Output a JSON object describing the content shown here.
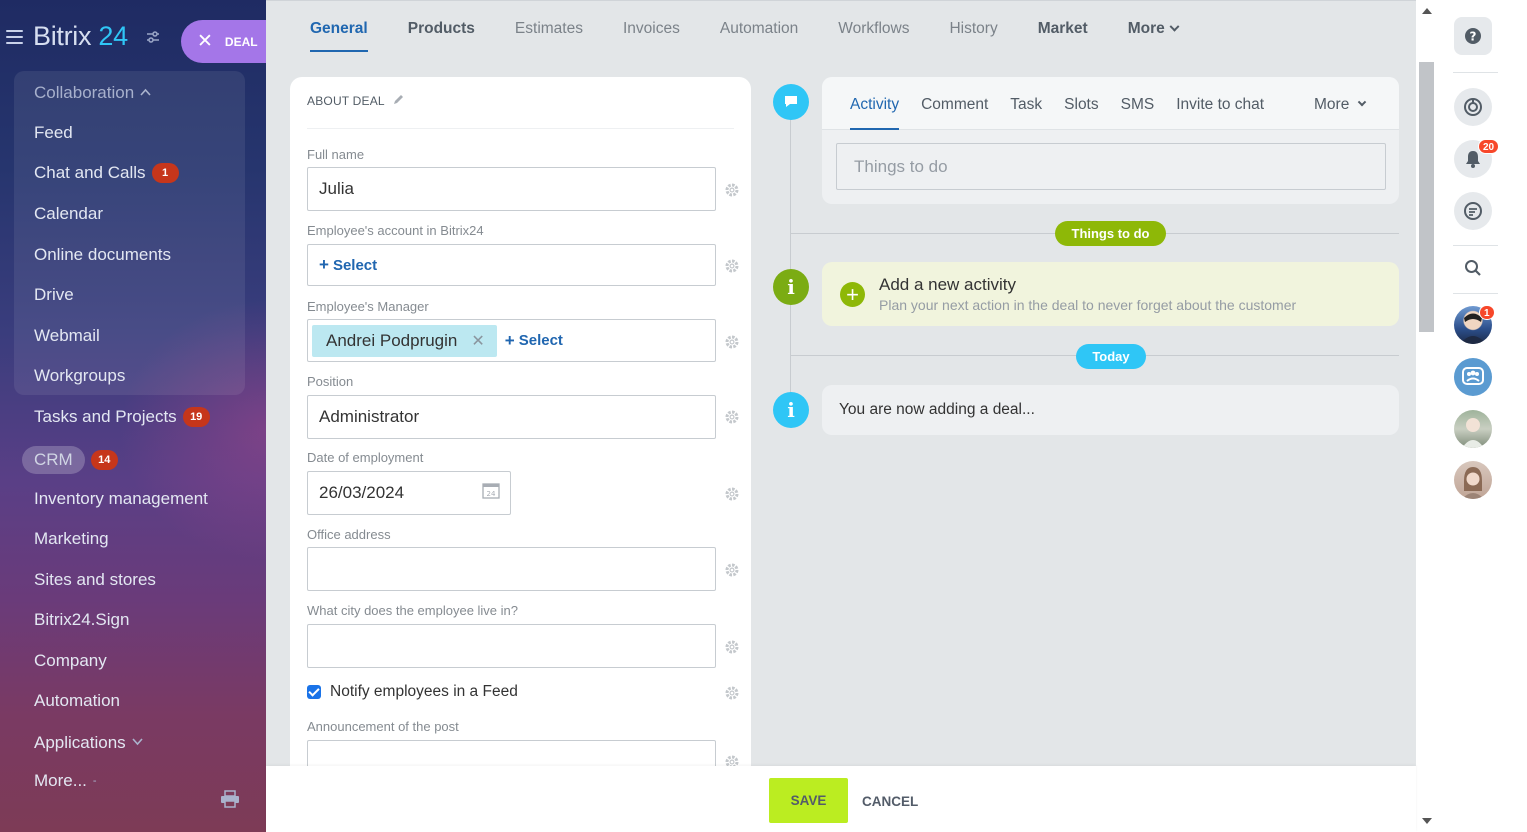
{
  "sidebar": {
    "logo": {
      "text": "Bitrix",
      "num": "24"
    },
    "deal_button": "DEAL",
    "items": [
      {
        "label": "Collaboration",
        "chevron": "^"
      },
      {
        "label": "Feed"
      },
      {
        "label": "Chat and Calls",
        "badge": "1"
      },
      {
        "label": "Calendar"
      },
      {
        "label": "Online documents"
      },
      {
        "label": "Drive"
      },
      {
        "label": "Webmail"
      },
      {
        "label": "Workgroups"
      },
      {
        "label": "Tasks and Projects",
        "badge": "19"
      },
      {
        "label": "CRM",
        "badge": "14"
      },
      {
        "label": "Inventory management"
      },
      {
        "label": "Marketing"
      },
      {
        "label": "Sites and stores"
      },
      {
        "label": "Bitrix24.Sign"
      },
      {
        "label": "Company"
      },
      {
        "label": "Automation"
      },
      {
        "label": "Applications"
      },
      {
        "label": "More..."
      }
    ]
  },
  "tabs": [
    "General",
    "Products",
    "Estimates",
    "Invoices",
    "Automation",
    "Workflows",
    "History",
    "Market",
    "More"
  ],
  "form": {
    "header": "ABOUT DEAL",
    "fields": {
      "full_name": {
        "label": "Full name",
        "value": "Julia"
      },
      "account": {
        "label": "Employee's account in Bitrix24",
        "select": "Select"
      },
      "manager": {
        "label": "Employee's Manager",
        "chip": "Andrei Podprugin",
        "select": "Select"
      },
      "position": {
        "label": "Position",
        "value": "Administrator"
      },
      "date": {
        "label": "Date of employment",
        "value": "26/03/2024"
      },
      "office": {
        "label": "Office address",
        "value": ""
      },
      "city": {
        "label": "What city does the employee live in?",
        "value": ""
      },
      "notify": {
        "label": "Notify employees in a Feed",
        "checked": true
      },
      "announcement": {
        "label": "Announcement of the post",
        "value": ""
      }
    }
  },
  "activity": {
    "tabs": [
      "Activity",
      "Comment",
      "Task",
      "Slots",
      "SMS",
      "Invite to chat"
    ],
    "more": "More",
    "todo_placeholder": "Things to do",
    "pill_todo": "Things to do",
    "add_title": "Add a new activity",
    "add_sub": "Plan your next action in the deal to never forget about the customer",
    "pill_today": "Today",
    "now_text": "You are now adding a deal..."
  },
  "bottom": {
    "save": "SAVE",
    "cancel": "CANCEL"
  },
  "right_panel": {
    "notifications_badge": "20",
    "avatar_badge": "1"
  },
  "colors": {
    "accent_blue": "#2067b0",
    "save_green": "#bbed21",
    "timeline_green": "#8eb807",
    "timeline_blue": "#2fc6f6",
    "badge_red": "#c6361b"
  }
}
